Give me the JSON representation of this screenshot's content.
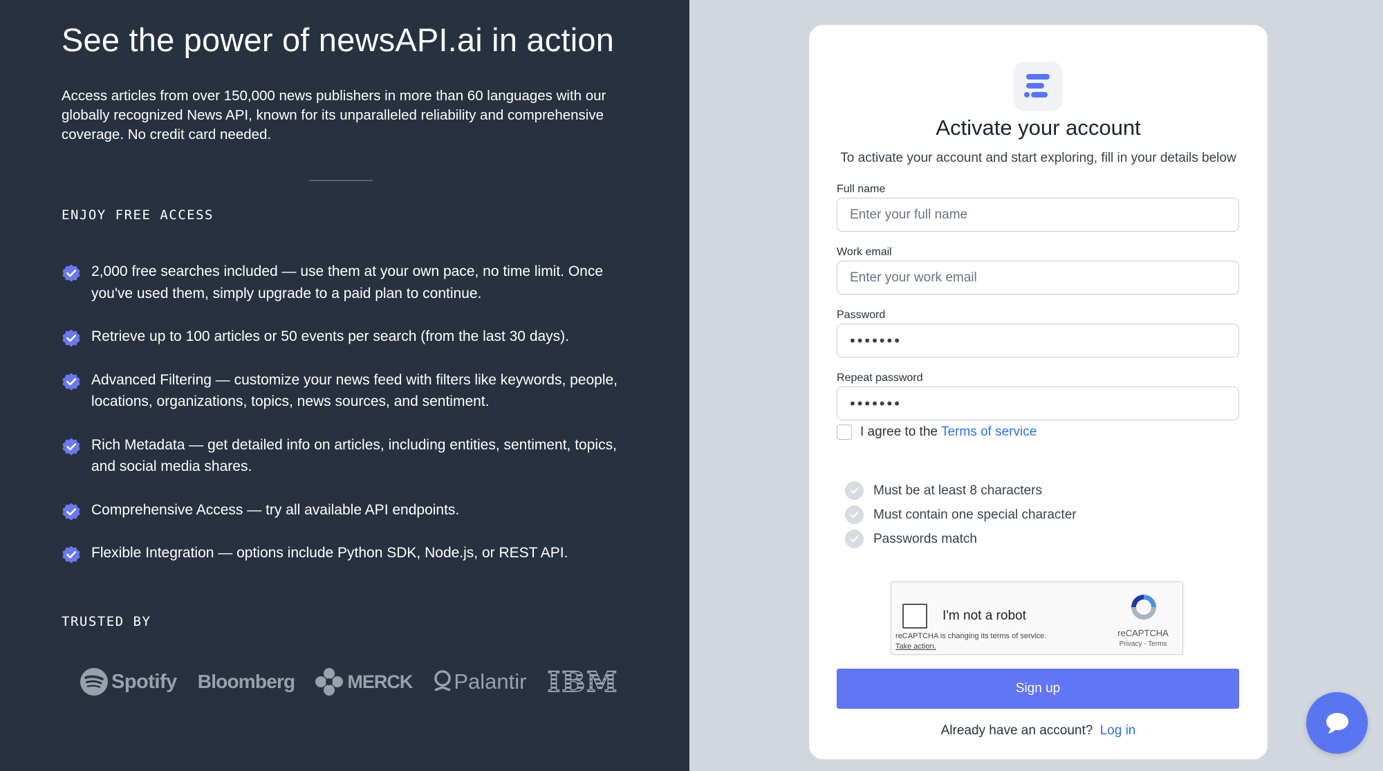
{
  "hero": {
    "title": "See the power of newsAPI.ai in action",
    "intro": "Access articles from over 150,000 news publishers in more than 60 languages with our globally recognized News API, known for its unparalleled reliability and comprehensive coverage. No credit card needed."
  },
  "free_access": {
    "heading": "ENJOY FREE ACCESS",
    "features": [
      "2,000 free searches included — use them at your own pace, no time limit. Once you've used them, simply upgrade to a paid plan to continue.",
      "Retrieve up to 100 articles or 50 events per search (from the last 30 days).",
      "Advanced Filtering — customize your news feed with filters like keywords, people, locations, organizations, topics, news sources, and sentiment.",
      "Rich Metadata — get detailed info on articles, including entities, sentiment, topics, and social media shares.",
      "Comprehensive Access — try all available API endpoints.",
      "Flexible Integration — options include Python SDK, Node.js, or REST API."
    ]
  },
  "trusted": {
    "heading": "TRUSTED BY",
    "logos": [
      "Spotify",
      "Bloomberg",
      "MERCK",
      "Palantir",
      "IBM"
    ]
  },
  "form": {
    "title": "Activate your account",
    "subtitle": "To activate your account and start exploring, fill in your details below",
    "full_name": {
      "label": "Full name",
      "placeholder": "Enter your full name"
    },
    "work_email": {
      "label": "Work email",
      "placeholder": "Enter your work email"
    },
    "password": {
      "label": "Password",
      "value": "•••••••"
    },
    "repeat_password": {
      "label": "Repeat password",
      "value": "•••••••"
    },
    "terms_prefix": "I agree to the",
    "terms_link": "Terms of service",
    "rules": [
      "Must be at least 8 characters",
      "Must contain one special character",
      "Passwords match"
    ],
    "captcha": {
      "label": "I'm not a robot",
      "notice": "reCAPTCHA is changing its terms of service.",
      "action": "Take action.",
      "brand": "reCAPTCHA",
      "links": "Privacy - Terms"
    },
    "submit_label": "Sign up",
    "login_prompt": "Already have an account?",
    "login_link": "Log in"
  },
  "colors": {
    "left_bg": "#283140",
    "accent": "#6176f5",
    "link": "#2f6fe0",
    "page_bg": "#d2d6de"
  },
  "icons": {
    "feature_bullet": "verified-badge-icon",
    "chat": "chat-bubble-icon",
    "app_logo": "newsapi-logo-icon"
  }
}
